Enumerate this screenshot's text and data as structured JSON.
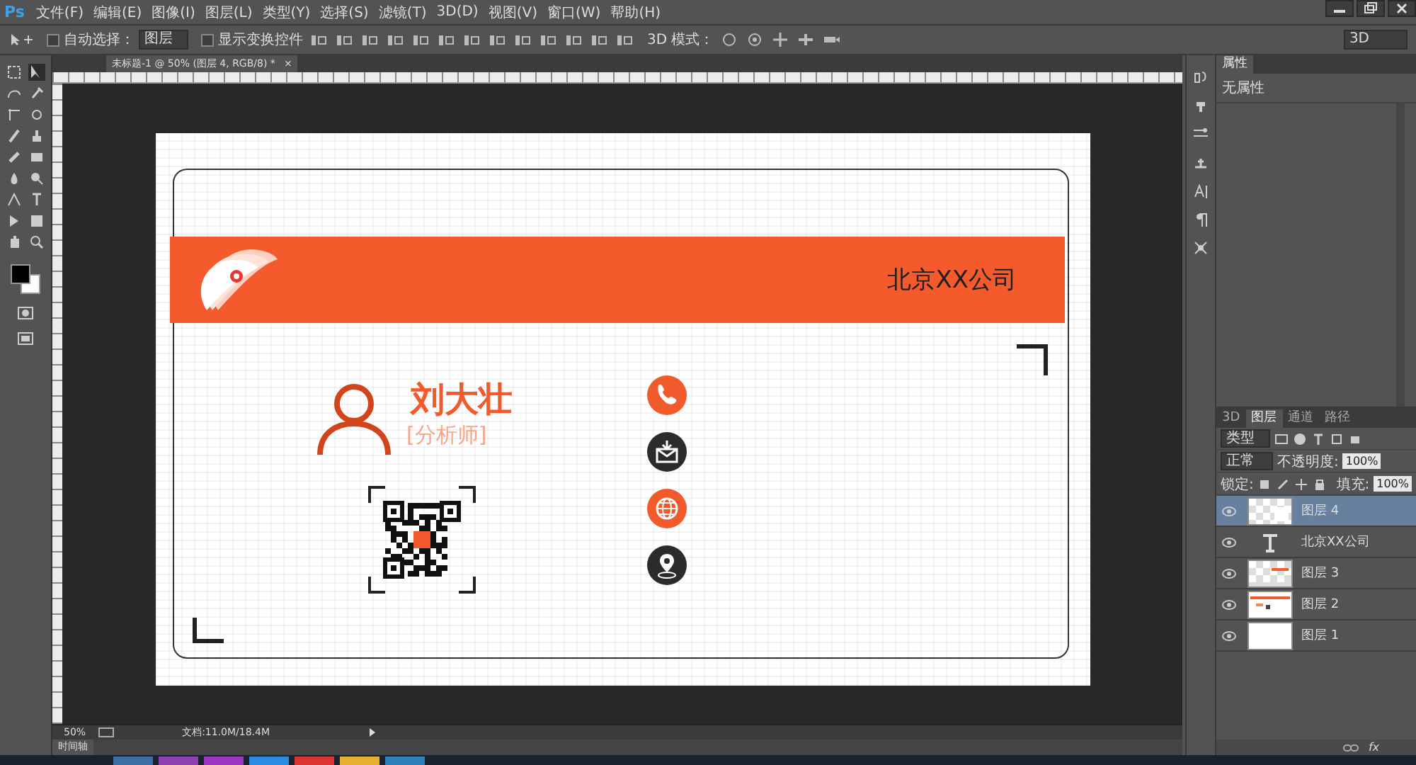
{
  "app": {
    "logo": "Ps"
  },
  "menu": [
    "文件(F)",
    "编辑(E)",
    "图像(I)",
    "图层(L)",
    "类型(Y)",
    "选择(S)",
    "滤镜(T)",
    "3D(D)",
    "视图(V)",
    "窗口(W)",
    "帮助(H)"
  ],
  "options_bar": {
    "auto_select": {
      "label": "自动选择：",
      "checked": false
    },
    "auto_select_target": "图层",
    "show_transform": {
      "label": "显示变换控件",
      "checked": false
    },
    "mode_label": "3D 模式：",
    "workspace": "3D"
  },
  "document_tab": {
    "title": "未标题-1 @ 50% (图层 4, RGB/8) *",
    "close": "×"
  },
  "card": {
    "company": "北京XX公司",
    "name": "刘大壮",
    "role": "[分析师]",
    "contacts": [
      {
        "kind": "phone",
        "color": "#f05a2c"
      },
      {
        "kind": "mail",
        "color": "#2b2b2b"
      },
      {
        "kind": "globe",
        "color": "#f05a2c"
      },
      {
        "kind": "location",
        "color": "#2b2b2b"
      }
    ]
  },
  "status_bar": {
    "zoom": "50%",
    "document": "文档:11.0M/18.4M"
  },
  "timeline_tab": "时间轴",
  "properties_panel": {
    "tab": "属性",
    "text": "无属性"
  },
  "layers_panel": {
    "tabs": [
      {
        "label": "3D",
        "selected": false
      },
      {
        "label": "图层",
        "selected": true
      },
      {
        "label": "通道",
        "selected": false
      },
      {
        "label": "路径",
        "selected": false
      }
    ],
    "filter": "类型",
    "blend_mode": "正常",
    "opacity_label": "不透明度:",
    "opacity": "100%",
    "lock_label": "锁定:",
    "fill_label": "填充:",
    "fill": "100%",
    "layers": [
      {
        "name": "图层 4",
        "kind": "empty",
        "selected": true
      },
      {
        "name": "北京XX公司",
        "kind": "text",
        "selected": false
      },
      {
        "name": "图层 3",
        "kind": "bar",
        "selected": false
      },
      {
        "name": "图层 2",
        "kind": "card",
        "selected": false
      },
      {
        "name": "图层 1",
        "kind": "white",
        "selected": false
      }
    ],
    "footer": "fx"
  }
}
